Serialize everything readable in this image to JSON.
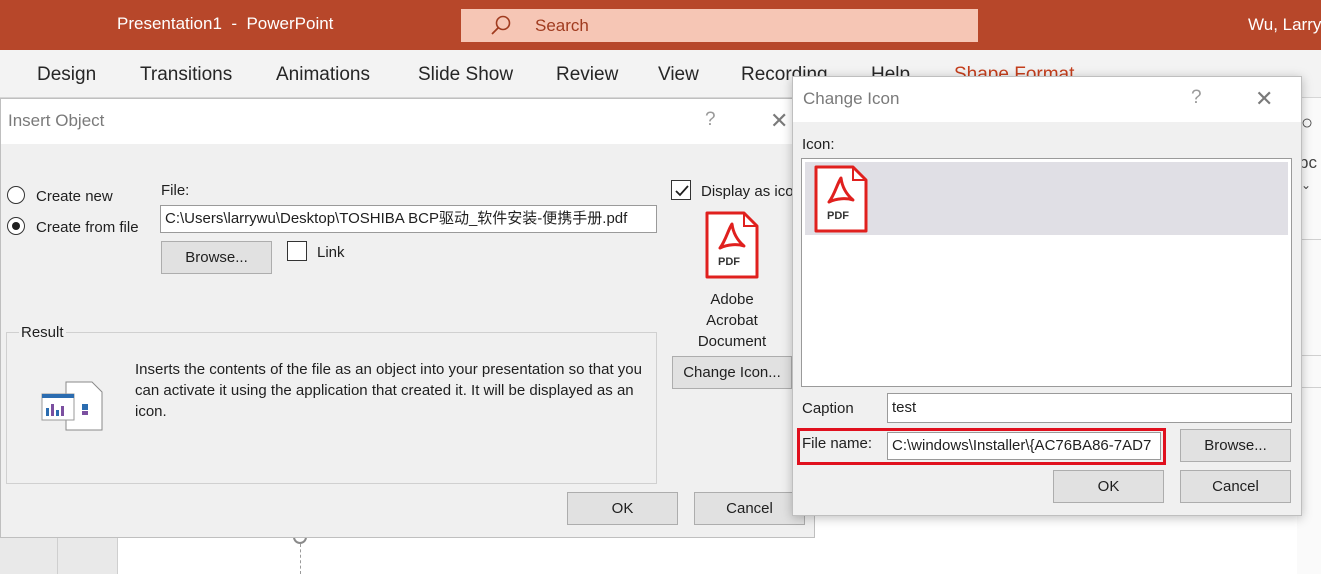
{
  "window": {
    "title": "Presentation1  -  PowerPoint",
    "search_placeholder": "Search",
    "user": "Wu, Larry"
  },
  "ribbon": {
    "tabs": [
      "Design",
      "Transitions",
      "Animations",
      "Slide Show",
      "Review",
      "View",
      "Recording",
      "Help",
      "Shape Format"
    ],
    "accent_color": "#c43e1c"
  },
  "insert_object": {
    "title": "Insert Object",
    "help": "?",
    "create_new": "Create new",
    "create_from_file": "Create from file",
    "selected_option": "create_from_file",
    "file_label": "File:",
    "file_value": "C:\\Users\\larrywu\\Desktop\\TOSHIBA BCP驱动_软件安装-便携手册.pdf",
    "browse": "Browse...",
    "link": "Link",
    "link_checked": false,
    "display_as_icon": "Display as icon",
    "display_as_icon_checked": true,
    "icon_caption": [
      "Adobe",
      "Acrobat",
      "Document"
    ],
    "pdf_badge": "PDF",
    "change_icon": "Change Icon...",
    "result_heading": "Result",
    "result_text": "Inserts the contents of the file as an object into your presentation so that you can activate it using the application that created it. It will be displayed as an icon.",
    "ok": "OK",
    "cancel": "Cancel"
  },
  "change_icon": {
    "title": "Change Icon",
    "help": "?",
    "icon_label": "Icon:",
    "pdf_badge": "PDF",
    "caption_label": "Caption",
    "caption_value": "test",
    "file_name_label": "File name:",
    "file_name_value": "C:\\windows\\Installer\\{AC76BA86-7AD7",
    "browse": "Browse...",
    "ok": "OK",
    "cancel": "Cancel",
    "highlight_color": "#e0101e"
  },
  "colors": {
    "title_bar": "#b7472a",
    "search_box": "#f6c6b5",
    "pdf_red": "#e0201e"
  }
}
